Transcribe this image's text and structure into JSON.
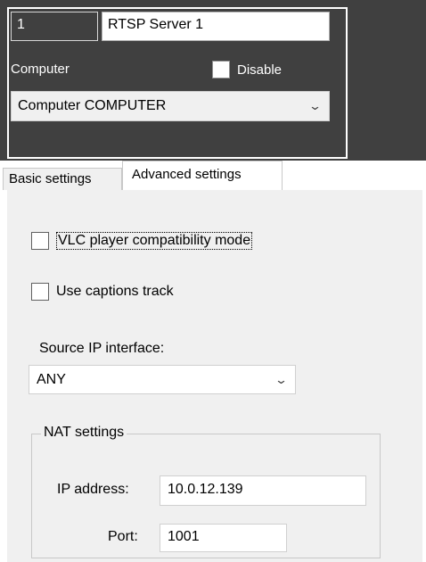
{
  "header": {
    "id_value": "1",
    "name_value": "RTSP Server 1",
    "computer_label": "Computer",
    "disable_label": "Disable",
    "disable_checked": false,
    "computer_selected": "Computer COMPUTER"
  },
  "tabs": [
    {
      "label": "Basic settings",
      "active": false
    },
    {
      "label": "Advanced settings",
      "active": true
    }
  ],
  "advanced": {
    "vlc_label": "VLC player compatibility mode",
    "vlc_checked": false,
    "captions_label": "Use captions track",
    "captions_checked": false,
    "source_ip_label": "Source IP interface:",
    "source_ip_selected": "ANY",
    "nat": {
      "legend": "NAT settings",
      "ip_label": "IP address:",
      "ip_value": "10.0.12.139",
      "port_label": "Port:",
      "port_value": "1001"
    }
  },
  "icons": {
    "dropdown": "chevron-down-icon"
  },
  "colors": {
    "header_bg": "#404040",
    "panel_bg": "#f0f0f0"
  }
}
